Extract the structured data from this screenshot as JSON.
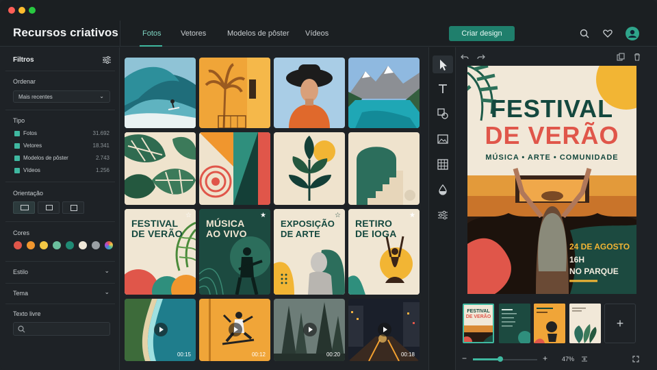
{
  "window": {
    "traffic_lights": [
      "#ff5f57",
      "#febc2e",
      "#28c840"
    ]
  },
  "header": {
    "brand": "Recursos criativos",
    "tabs": [
      {
        "label": "Fotos",
        "active": true
      },
      {
        "label": "Vetores",
        "active": false
      },
      {
        "label": "Modelos de pôster",
        "active": false
      },
      {
        "label": "Vídeos",
        "active": false
      }
    ],
    "cta_label": "Criar design",
    "icons": [
      "search-icon",
      "heart-icon",
      "user-avatar-icon"
    ]
  },
  "sidebar": {
    "title": "Filtros",
    "order_label": "Ordenar",
    "order_value": "Mais recentes",
    "type_label": "Tipo",
    "types": [
      {
        "label": "Fotos",
        "count": "31.692"
      },
      {
        "label": "Vetores",
        "count": "18.341"
      },
      {
        "label": "Modelos de pôster",
        "count": "2.743"
      },
      {
        "label": "Vídeos",
        "count": "1.256"
      }
    ],
    "orientation_label": "Orientação",
    "orientations": [
      "landscape",
      "square",
      "portrait"
    ],
    "colors_label": "Cores",
    "colors": [
      "#e0564a",
      "#f0962e",
      "#f2c744",
      "#6bbf9d",
      "#1f8a74",
      "#efe7d8",
      "#9aa0a4",
      "multicolor"
    ],
    "style_label": "Estilo",
    "theme_label": "Tema",
    "freetext_label": "Texto livre",
    "freetext_placeholder": ""
  },
  "grid": {
    "photos": [
      "wave-surfer-photo",
      "palm-shadow-photo",
      "woman-hat-photo",
      "mountain-lake-photo"
    ],
    "vectors": [
      "monstera-leaves-vector",
      "geometric-shapes-vector",
      "plant-sun-vector",
      "arch-stairs-vector"
    ],
    "posters": [
      {
        "line1": "FESTIVAL",
        "line2": "DE VERÃO"
      },
      {
        "line1": "MÚSICA",
        "line2": "AO VIVO"
      },
      {
        "line1": "EXPOSIÇÃO",
        "line2": "DE ARTE"
      },
      {
        "line1": "RETIRO",
        "line2": "DE IOGA"
      }
    ],
    "videos": [
      {
        "duration": "00:15"
      },
      {
        "duration": "00:12"
      },
      {
        "duration": "00:20"
      },
      {
        "duration": "00:18"
      }
    ]
  },
  "editor": {
    "poster": {
      "title_line1": "FESTIVAL",
      "title_line2": "DE VERÃO",
      "tagline": "MÚSICA • ARTE • COMUNIDADE",
      "date": "24 DE AGOSTO",
      "time": "16H",
      "place": "NO PARQUE"
    },
    "thumbs": [
      {
        "line1": "FESTIVAL",
        "line2": "DE VERÃO"
      },
      {
        "line1": "",
        "line2": ""
      },
      {
        "line1": "",
        "line2": ""
      },
      {
        "line1": "",
        "line2": ""
      }
    ],
    "zoom": "47%",
    "zoom_fraction": 0.43
  }
}
